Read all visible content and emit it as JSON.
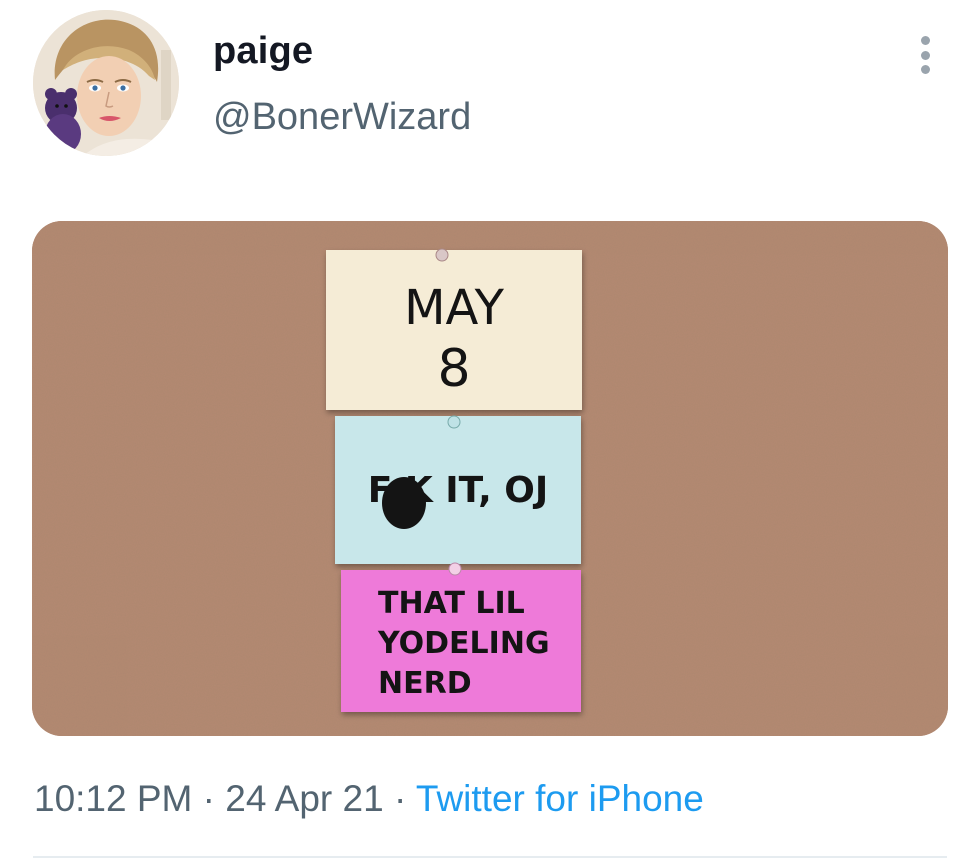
{
  "tweet": {
    "author": {
      "display_name": "paige",
      "handle": "@BonerWizard",
      "avatar_icon": "profile-portrait-avatar"
    },
    "more_icon": "more-vertical-icon",
    "image": {
      "notes": [
        {
          "lines": [
            "MAY",
            "8"
          ],
          "color": "#f5ecd6"
        },
        {
          "lines": [
            "F  K IT, OJ"
          ],
          "color": "#c8e7ea"
        },
        {
          "lines": [
            "THAT LIL",
            "YODELING",
            "NERD"
          ],
          "color": "#ee7ad9"
        }
      ],
      "background_color": "#b58a72"
    },
    "meta": {
      "time": "10:12 PM",
      "separator": "·",
      "date": "24 Apr 21",
      "source": "Twitter for iPhone"
    },
    "colors": {
      "name": "#141823",
      "secondary": "#536471",
      "link": "#1d9bf0"
    }
  }
}
